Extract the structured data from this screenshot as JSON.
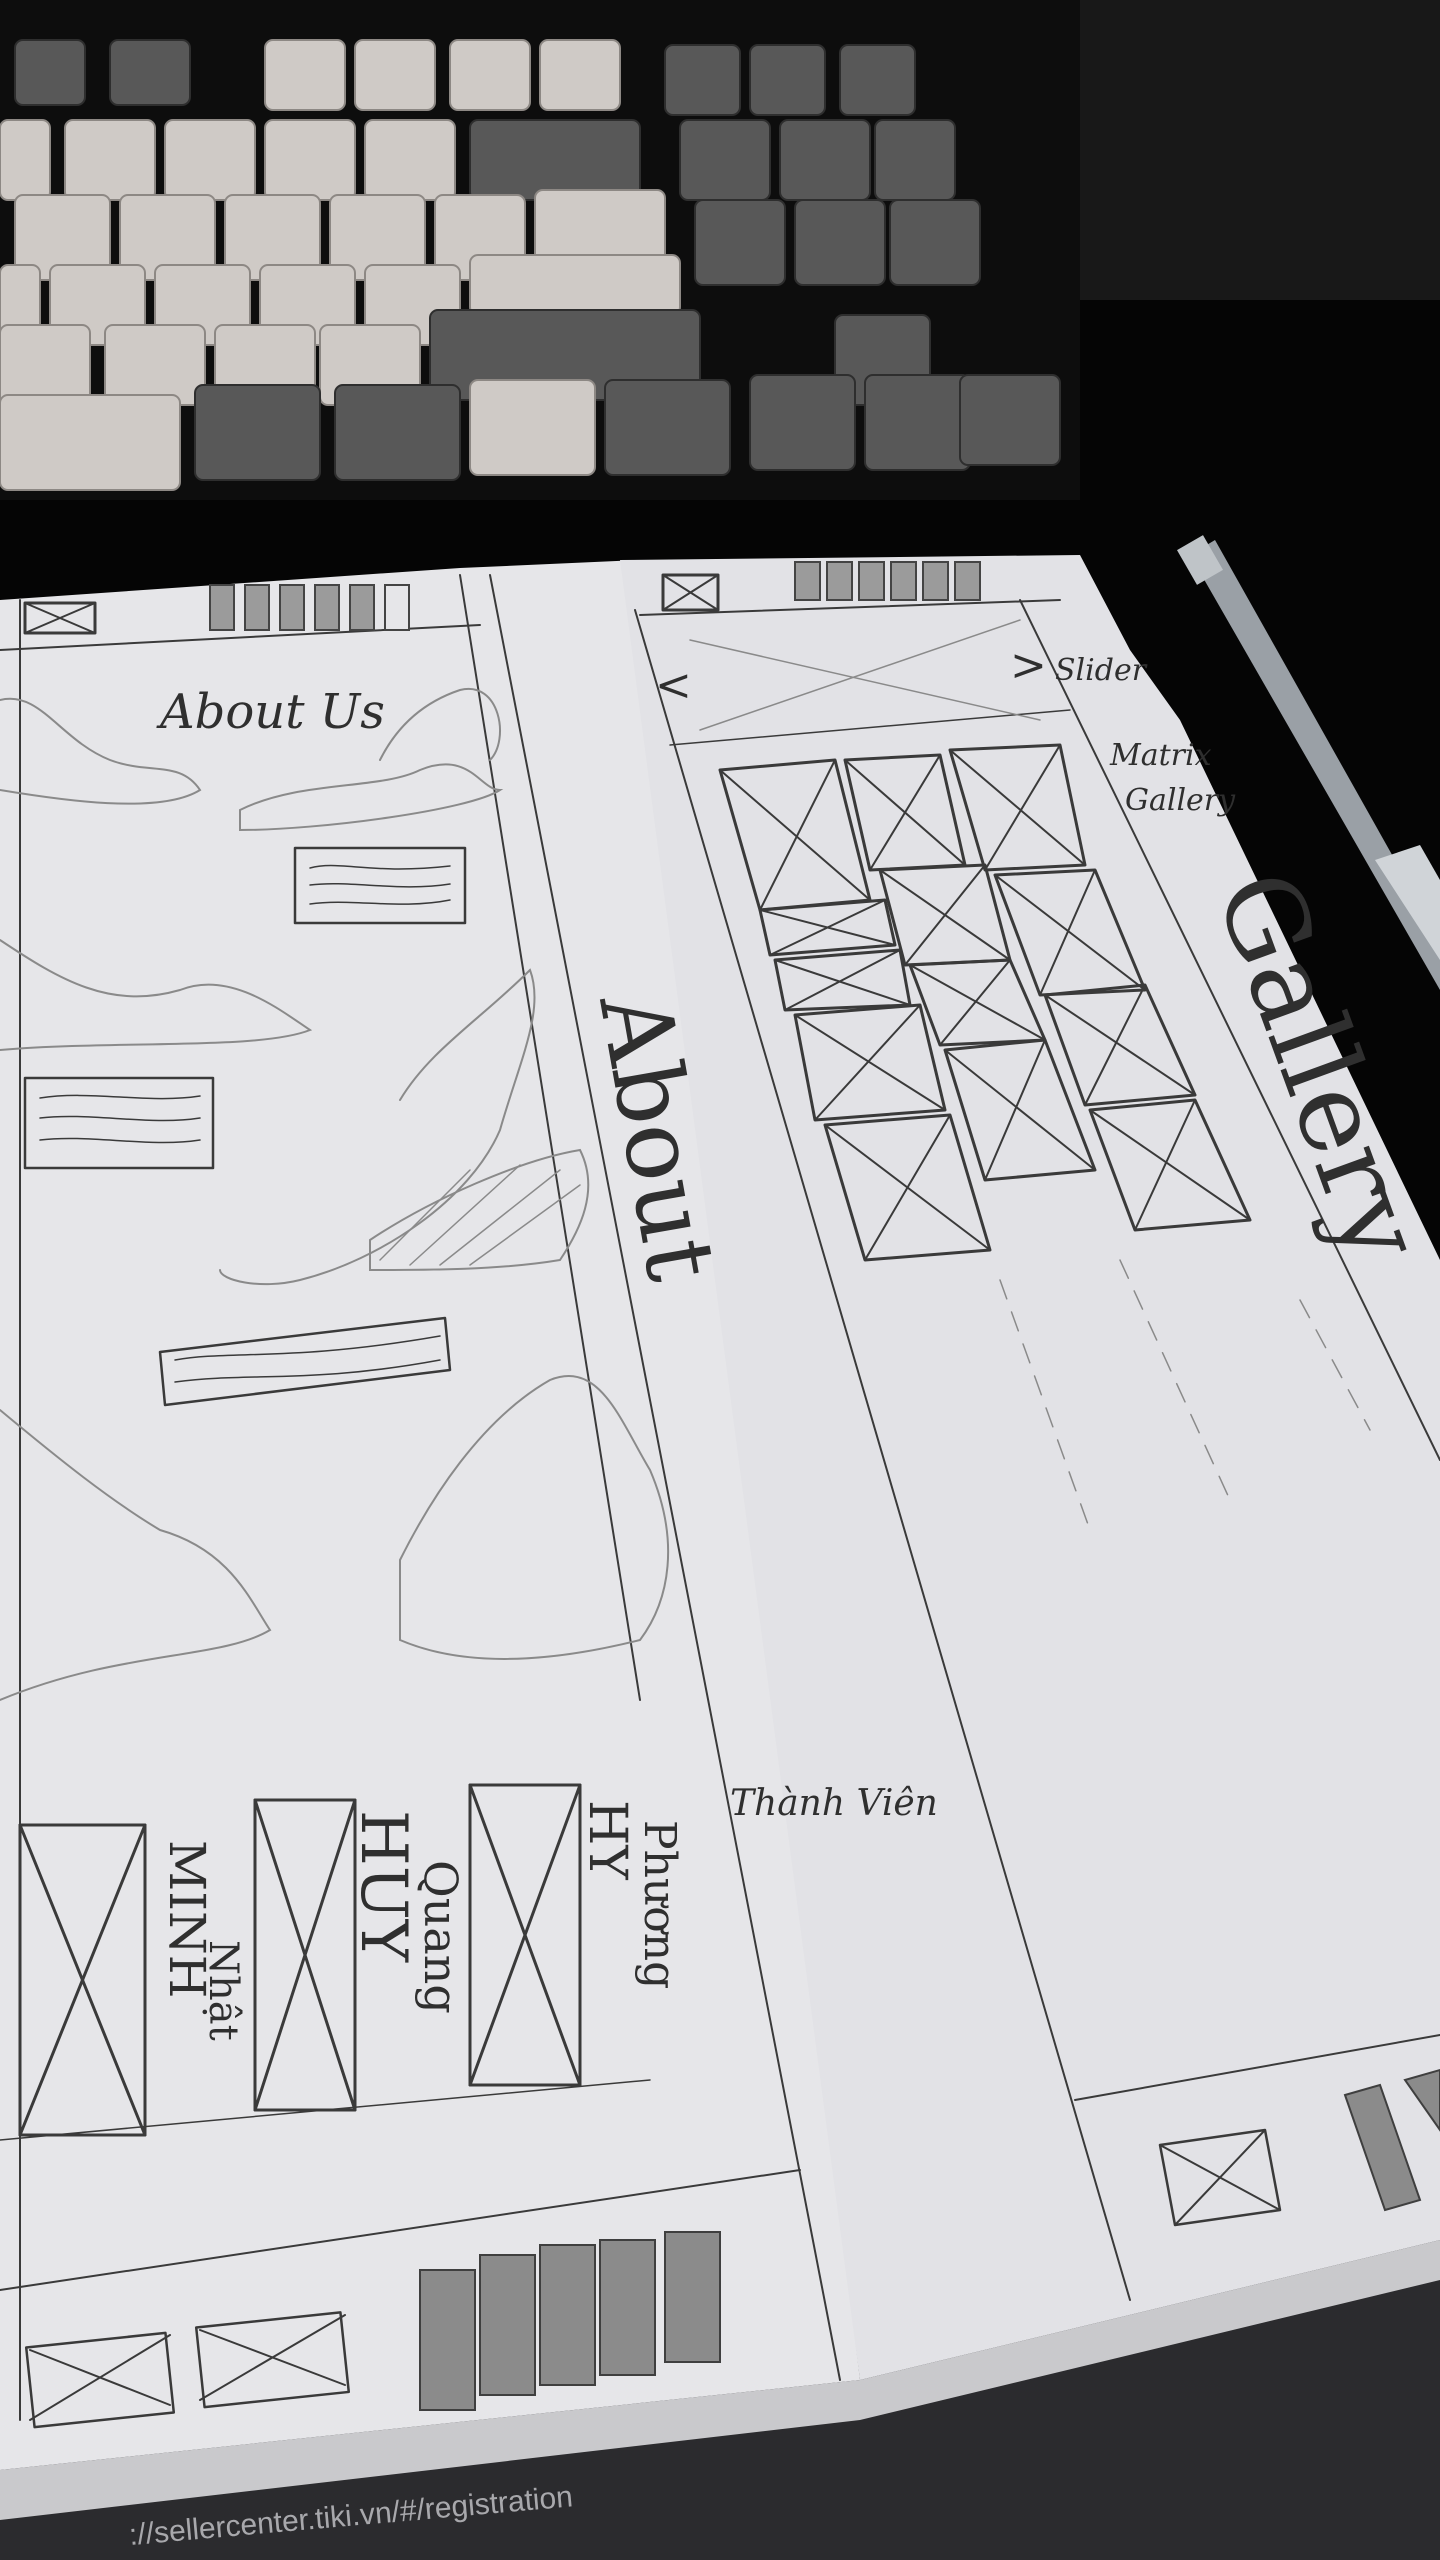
{
  "scene": {
    "subject": "hand-drawn-website-wireframe-sketches",
    "colors": {
      "background": "#050505",
      "paper": "#e8e8ea",
      "pencil": "#3a3a3a",
      "keycap_light": "#cfcac6",
      "keycap_dark": "#585858"
    }
  },
  "left_sheet": {
    "heading": "About Us",
    "section_label": "About",
    "members": [
      {
        "name": "MINH",
        "surname": "Nhật"
      },
      {
        "name": "HUY",
        "surname": "Quang"
      },
      {
        "name": "HY",
        "surname": "Phương"
      }
    ],
    "members_label": "Thành Viên"
  },
  "right_sheet": {
    "slider_label": "Slider",
    "prev_arrow": "<",
    "next_arrow": ">",
    "gallery_label_line1": "Matrix",
    "gallery_label_line2": "Gallery",
    "section_label": "Gallery"
  },
  "bottom_text": "://sellercenter.tiki.vn/#/registration"
}
